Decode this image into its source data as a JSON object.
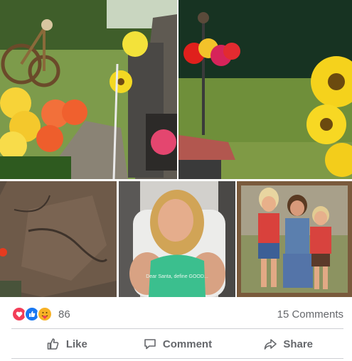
{
  "reactions": {
    "types": [
      "love-icon",
      "like-icon",
      "care-icon"
    ],
    "count": "86"
  },
  "comments": {
    "count_label": "15 Comments"
  },
  "actions": {
    "like_label": "Like",
    "comment_label": "Comment",
    "share_label": "Share"
  },
  "photos": [
    {
      "name": "photo-memorial-bicycle-flowers"
    },
    {
      "name": "photo-roadside-flowers-sunflower"
    },
    {
      "name": "photo-rock-with-flower"
    },
    {
      "name": "photo-smiling-woman"
    },
    {
      "name": "photo-three-children"
    }
  ],
  "photo_text": {
    "shirt_text": "Dear Santa, define GOOD..."
  },
  "colors": {
    "text_primary": "#050505",
    "text_secondary": "#65676b",
    "like_blue": "#1877f2",
    "love_red": "#f33e58",
    "care_yellow": "#f7b125",
    "divider": "#ced0d4"
  }
}
